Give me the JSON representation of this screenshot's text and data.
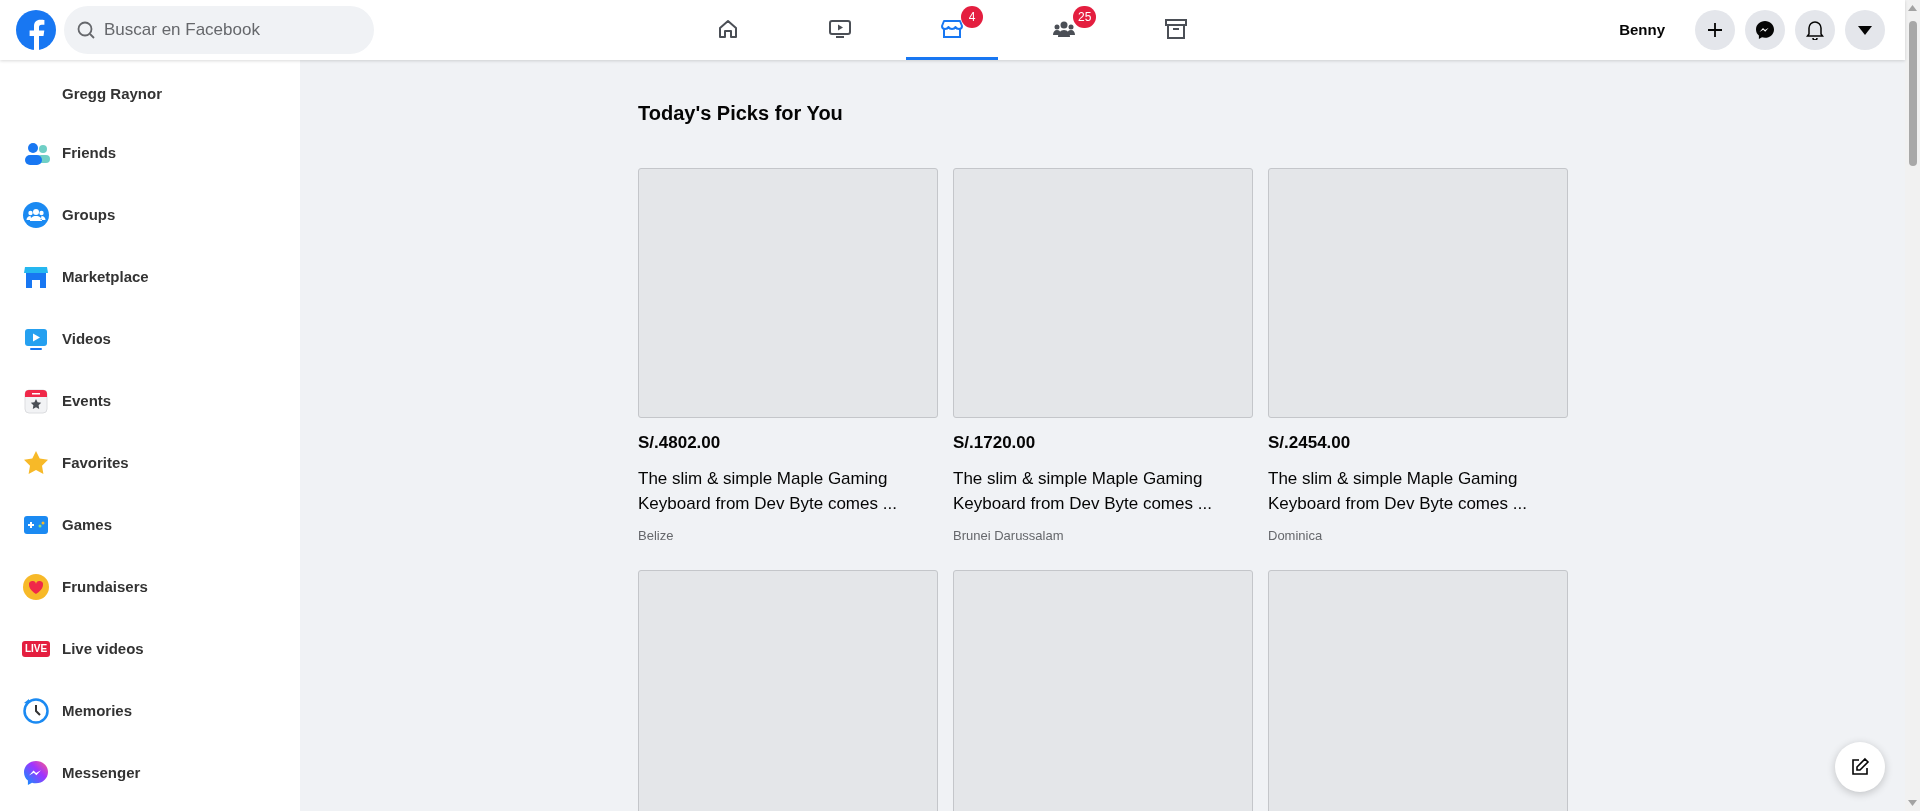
{
  "header": {
    "search": {
      "placeholder": "Buscar en Facebook"
    },
    "nav_tabs": [
      {
        "kind": "home",
        "selected": false
      },
      {
        "kind": "watch",
        "selected": false
      },
      {
        "kind": "marketplace",
        "selected": true,
        "badge": "4"
      },
      {
        "kind": "groups",
        "selected": false,
        "badge": "25"
      },
      {
        "kind": "archive",
        "selected": false
      }
    ],
    "user_name": "Benny"
  },
  "sidebar": {
    "items": [
      {
        "kind": "profile",
        "label": "Gregg Raynor"
      },
      {
        "kind": "friends",
        "label": "Friends"
      },
      {
        "kind": "groups",
        "label": "Groups"
      },
      {
        "kind": "marketplace",
        "label": "Marketplace"
      },
      {
        "kind": "videos",
        "label": "Videos"
      },
      {
        "kind": "events",
        "label": "Events"
      },
      {
        "kind": "favorites",
        "label": "Favorites"
      },
      {
        "kind": "games",
        "label": "Games"
      },
      {
        "kind": "fundraisers",
        "label": "Frundaisers"
      },
      {
        "kind": "live",
        "label": "Live videos",
        "icon_text": "LIVE"
      },
      {
        "kind": "memories",
        "label": "Memories"
      },
      {
        "kind": "messenger",
        "label": "Messenger"
      }
    ]
  },
  "section_title": "Today's Picks for You",
  "listings": [
    {
      "kind": "full",
      "price": "S/.4802.00",
      "title": "The slim & simple Maple Gaming Keyboard from Dev Byte comes ...",
      "location": "Belize"
    },
    {
      "kind": "full",
      "price": "S/.1720.00",
      "title": "The slim & simple Maple Gaming Keyboard from Dev Byte comes ...",
      "location": "Brunei Darussalam"
    },
    {
      "kind": "full",
      "price": "S/.2454.00",
      "title": "The slim & simple Maple Gaming Keyboard from Dev Byte comes ...",
      "location": "Dominica"
    },
    {
      "kind": "image_only"
    },
    {
      "kind": "image_only"
    },
    {
      "kind": "image_only"
    }
  ]
}
